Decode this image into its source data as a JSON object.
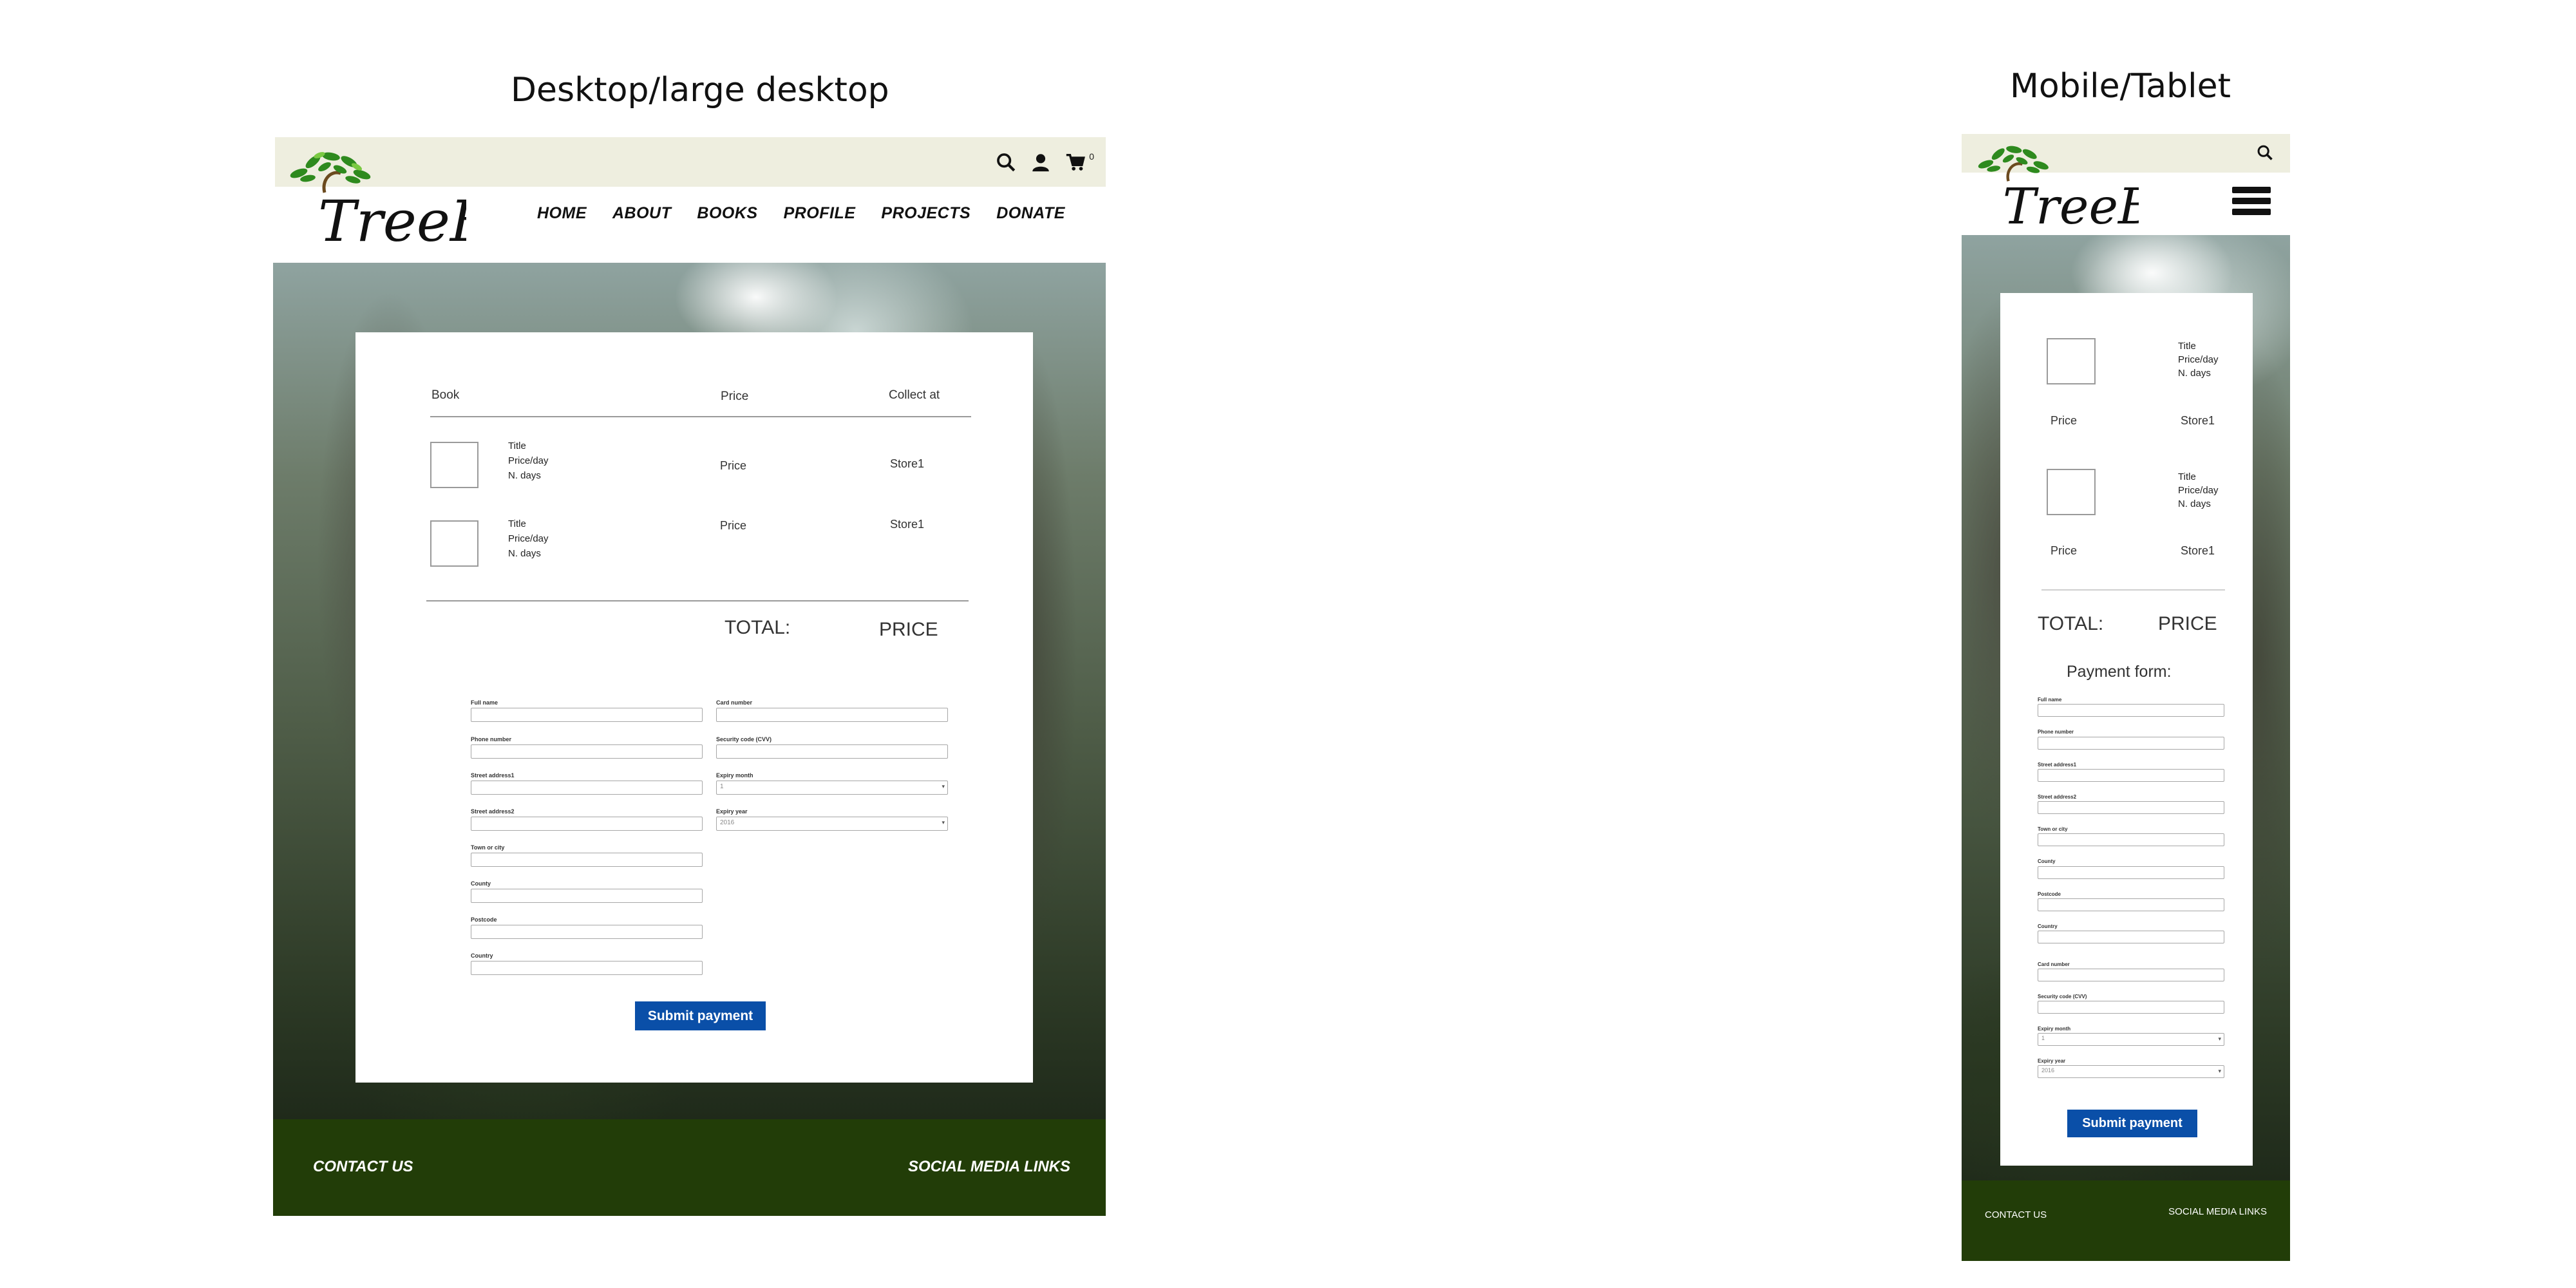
{
  "titles": {
    "desktop": "Desktop/large desktop",
    "mobile": "Mobile/Tablet"
  },
  "brand": {
    "logo_text": "TreeBooks"
  },
  "nav": [
    "HOME",
    "ABOUT",
    "BOOKS",
    "PROFILE",
    "PROJECTS",
    "DONATE"
  ],
  "header_icons": {
    "search": "search-icon",
    "user": "user-icon",
    "cart": "cart-icon",
    "cart_count": "0"
  },
  "cart": {
    "headers": {
      "book": "Book",
      "price": "Price",
      "collect": "Collect at"
    },
    "items": [
      {
        "title": "Title",
        "price_day": "Price/day",
        "days": "N. days",
        "price": "Price",
        "store": "Store1"
      },
      {
        "title": "Title",
        "price_day": "Price/day",
        "days": "N. days",
        "price": "Price",
        "store": "Store1"
      }
    ],
    "total_label": "TOTAL:",
    "total_value": "PRICE"
  },
  "payment_form": {
    "heading": "Payment form:",
    "left_fields": [
      "Full name",
      "Phone number",
      "Street address1",
      "Street address2",
      "Town or city",
      "County",
      "Postcode",
      "Country"
    ],
    "right_fields": [
      "Card number",
      "Security code (CVV)",
      "Expiry month",
      "Expiry year"
    ],
    "expiry_month_value": "1",
    "expiry_year_value": "2016",
    "submit_label": "Submit payment"
  },
  "footer": {
    "contact": "CONTACT US",
    "social": "SOCIAL MEDIA LINKS"
  },
  "colors": {
    "topbar": "#eeeedf",
    "footer": "#223d08",
    "button": "#0a4fa8"
  }
}
